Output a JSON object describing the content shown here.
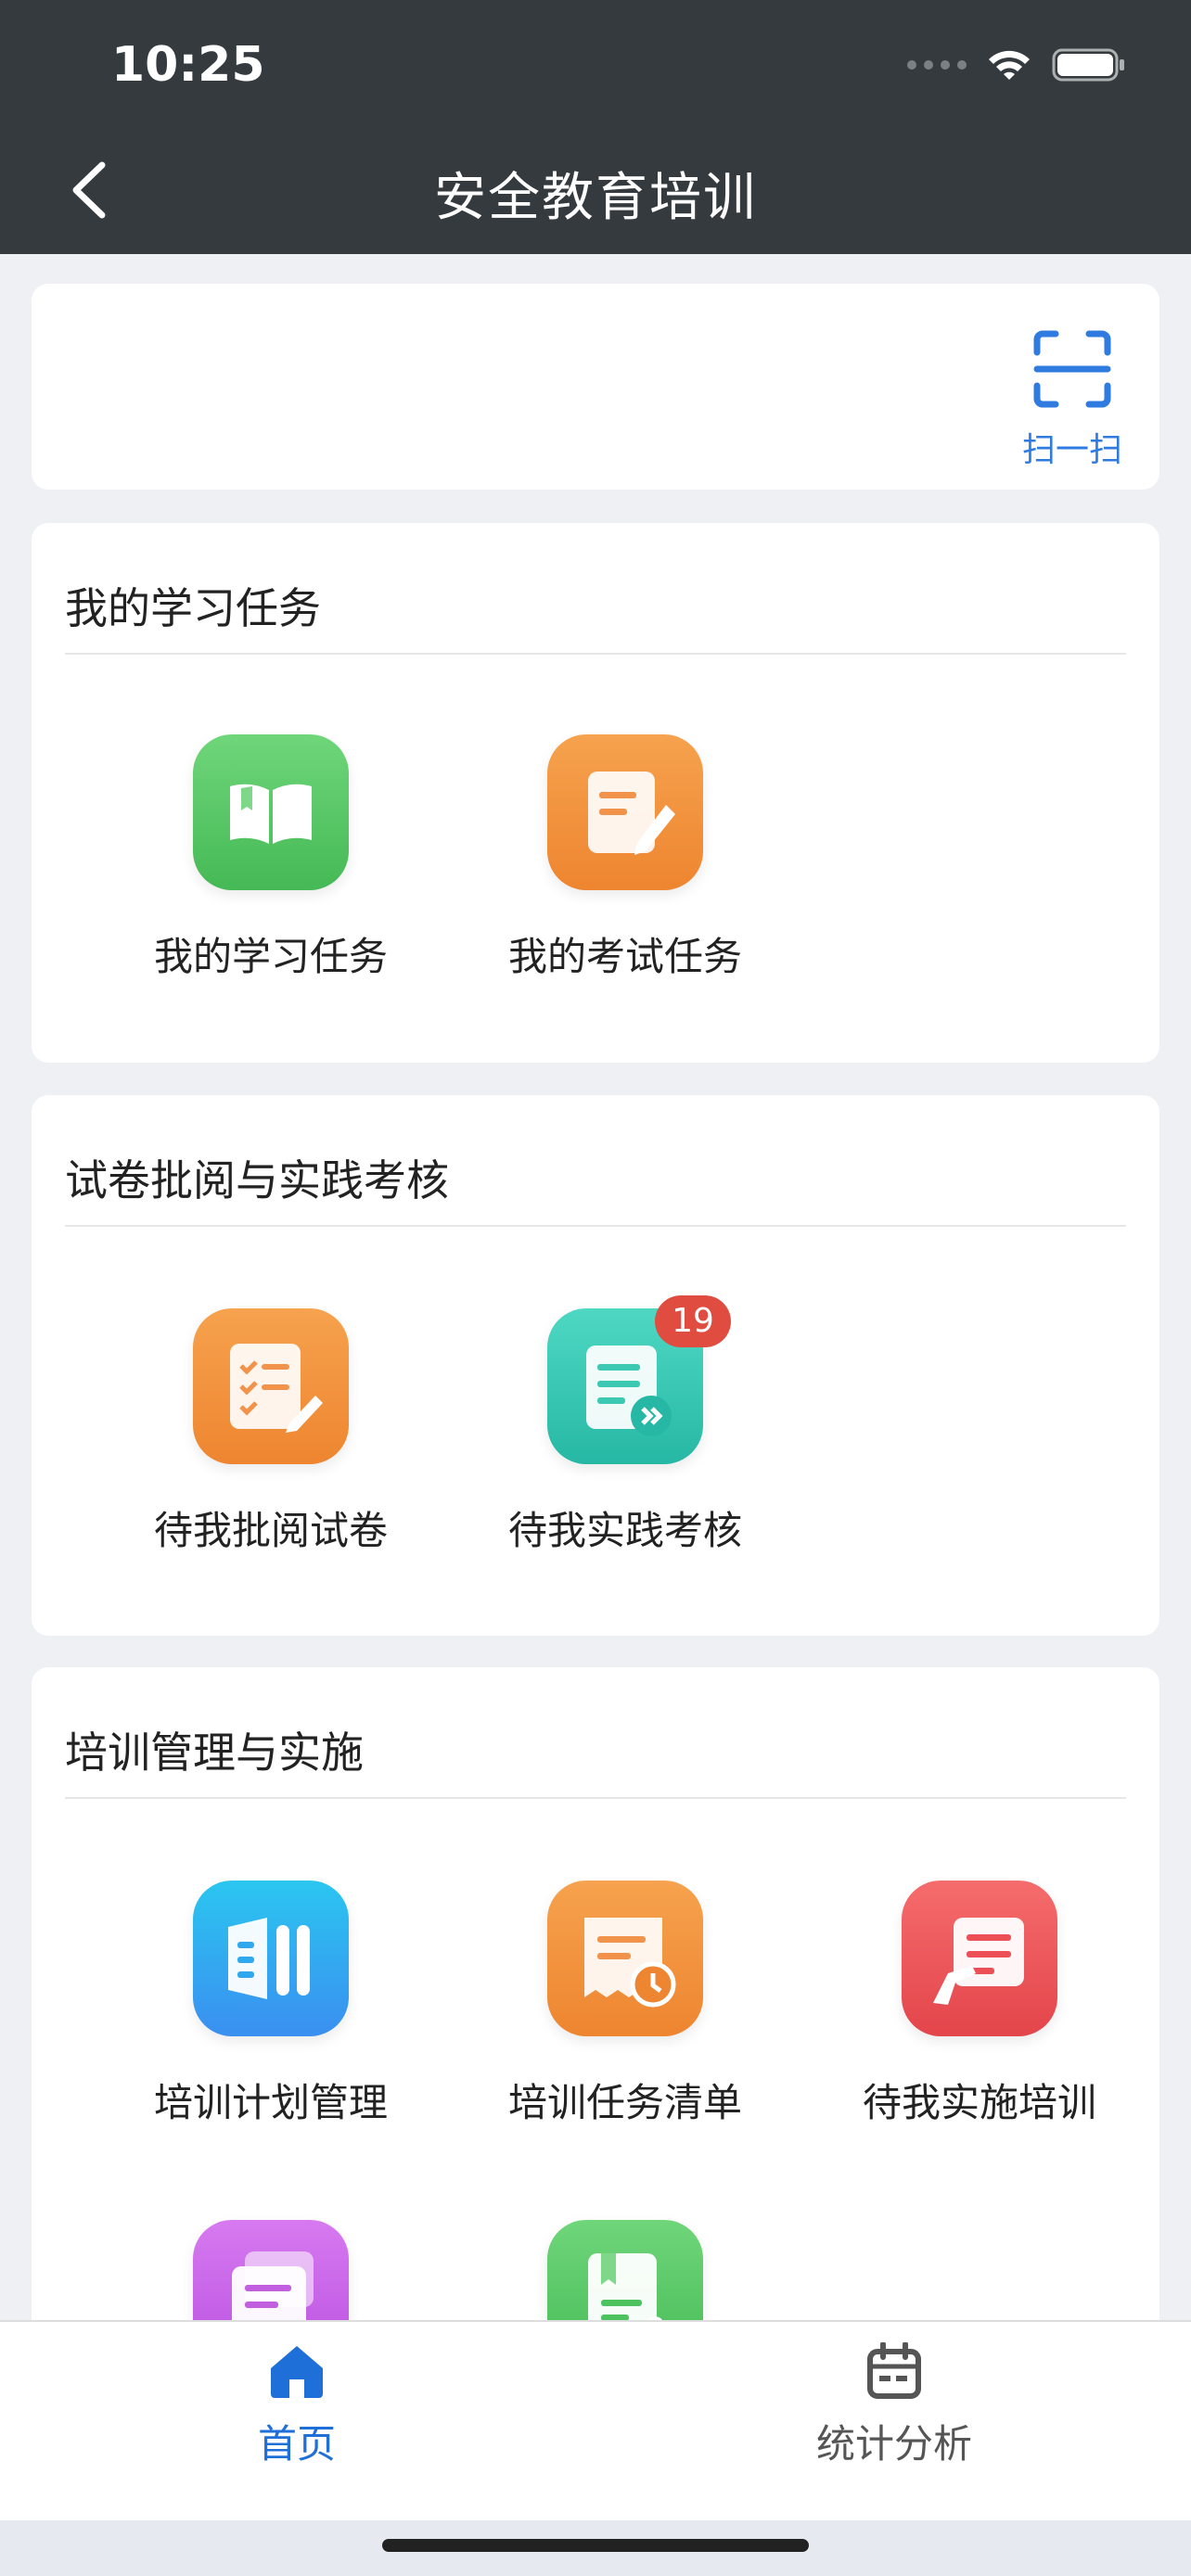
{
  "status": {
    "time": "10:25"
  },
  "nav": {
    "title": "安全教育培训"
  },
  "scan": {
    "label": "扫一扫"
  },
  "sections": [
    {
      "title": "我的学习任务",
      "items": [
        {
          "label": "我的学习任务",
          "icon": "book-icon",
          "color": "#4cc35f"
        },
        {
          "label": "我的考试任务",
          "icon": "edit-document-icon",
          "color": "#f08a2f"
        }
      ]
    },
    {
      "title": "试卷批阅与实践考核",
      "items": [
        {
          "label": "待我批阅试卷",
          "icon": "checklist-pen-icon",
          "color": "#f08a2f"
        },
        {
          "label": "待我实践考核",
          "icon": "document-forward-icon",
          "color": "#2ec4ae",
          "badge": "19"
        }
      ]
    },
    {
      "title": "培训管理与实施",
      "items": [
        {
          "label": "培训计划管理",
          "icon": "plan-board-icon",
          "color": "#23a7ee"
        },
        {
          "label": "培训任务清单",
          "icon": "receipt-clock-icon",
          "color": "#f08a2f"
        },
        {
          "label": "待我实施培训",
          "icon": "presentation-icon",
          "color": "#ec4f55"
        },
        {
          "label": "",
          "icon": "stacked-cards-icon",
          "color": "#c25fe0"
        },
        {
          "label": "",
          "icon": "book-bookmark-icon",
          "color": "#4cc35f"
        }
      ]
    }
  ],
  "tabbar": {
    "items": [
      {
        "label": "首页",
        "icon": "home-icon",
        "active": true,
        "color": "#1f6fd8"
      },
      {
        "label": "统计分析",
        "icon": "calendar-icon",
        "active": false,
        "color": "#555555"
      }
    ]
  }
}
